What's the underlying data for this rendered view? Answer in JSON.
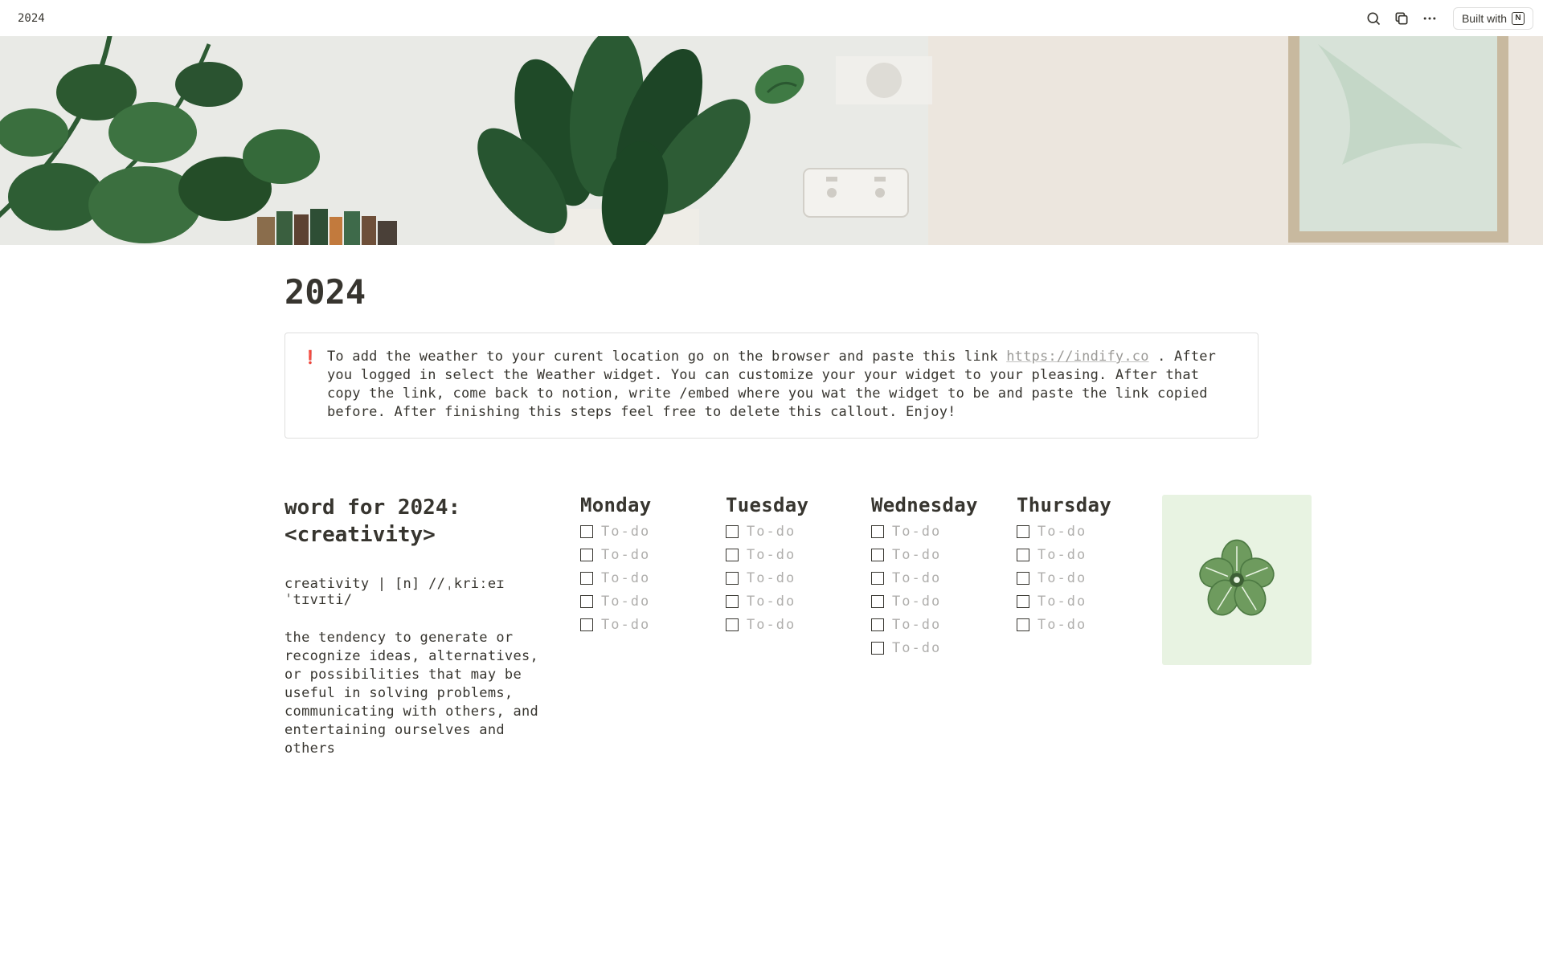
{
  "topbar": {
    "breadcrumb": "2024",
    "built_with": "Built with"
  },
  "page": {
    "title": "2024"
  },
  "callout": {
    "icon": "❗",
    "text_before": "To add the weather to your curent location go on the browser and paste this link ",
    "link_text": "https://indify.co",
    "text_after": " . After you logged in select the Weather widget. You can customize your your widget to your pleasing. After that copy the link, come back to notion, write /embed where you wat the widget to be and paste the link copied before. After finishing this steps feel free to delete this callout. Enjoy!"
  },
  "word": {
    "heading_line1": "word for 2024:",
    "heading_line2": "<creativity>",
    "pronunciation": "creativity | [n] //ˌkriːeɪˈtɪvɪti/",
    "definition": "the tendency to generate or recognize ideas, alternatives, or possibilities that may be useful in solving problems, communicating with others, and entertaining ourselves and others"
  },
  "days": [
    {
      "name": "Monday",
      "todos": [
        "To-do",
        "To-do",
        "To-do",
        "To-do",
        "To-do"
      ]
    },
    {
      "name": "Tuesday",
      "todos": [
        "To-do",
        "To-do",
        "To-do",
        "To-do",
        "To-do"
      ]
    },
    {
      "name": "Wednesday",
      "todos": [
        "To-do",
        "To-do",
        "To-do",
        "To-do",
        "To-do",
        "To-do"
      ]
    },
    {
      "name": "Thursday",
      "todos": [
        "To-do",
        "To-do",
        "To-do",
        "To-do",
        "To-do"
      ]
    }
  ]
}
